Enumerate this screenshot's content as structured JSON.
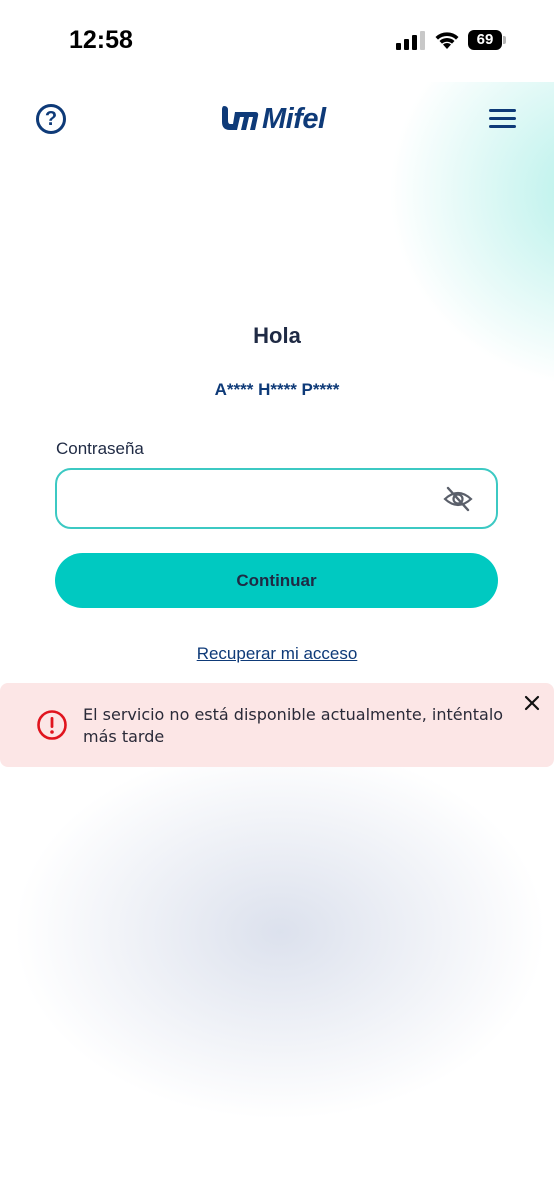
{
  "status_bar": {
    "time": "12:58",
    "battery": "69"
  },
  "header": {
    "logo_text": "Mifel",
    "help_icon": "question-circle-icon",
    "menu_icon": "hamburger-menu-icon"
  },
  "login": {
    "greeting": "Hola",
    "masked_user": "A**** H**** P****",
    "password_label": "Contraseña",
    "password_value": "",
    "continue_label": "Continuar",
    "recover_label": "Recuperar mi acceso"
  },
  "error_toast": {
    "message": "El servicio no está disponible actualmente, inténtalo más tarde",
    "icon": "exclamation-circle-icon"
  },
  "colors": {
    "brand_navy": "#0e3a78",
    "accent_teal": "#00c9c1",
    "error_red": "#e0141e",
    "error_bg": "#fce6e6"
  }
}
